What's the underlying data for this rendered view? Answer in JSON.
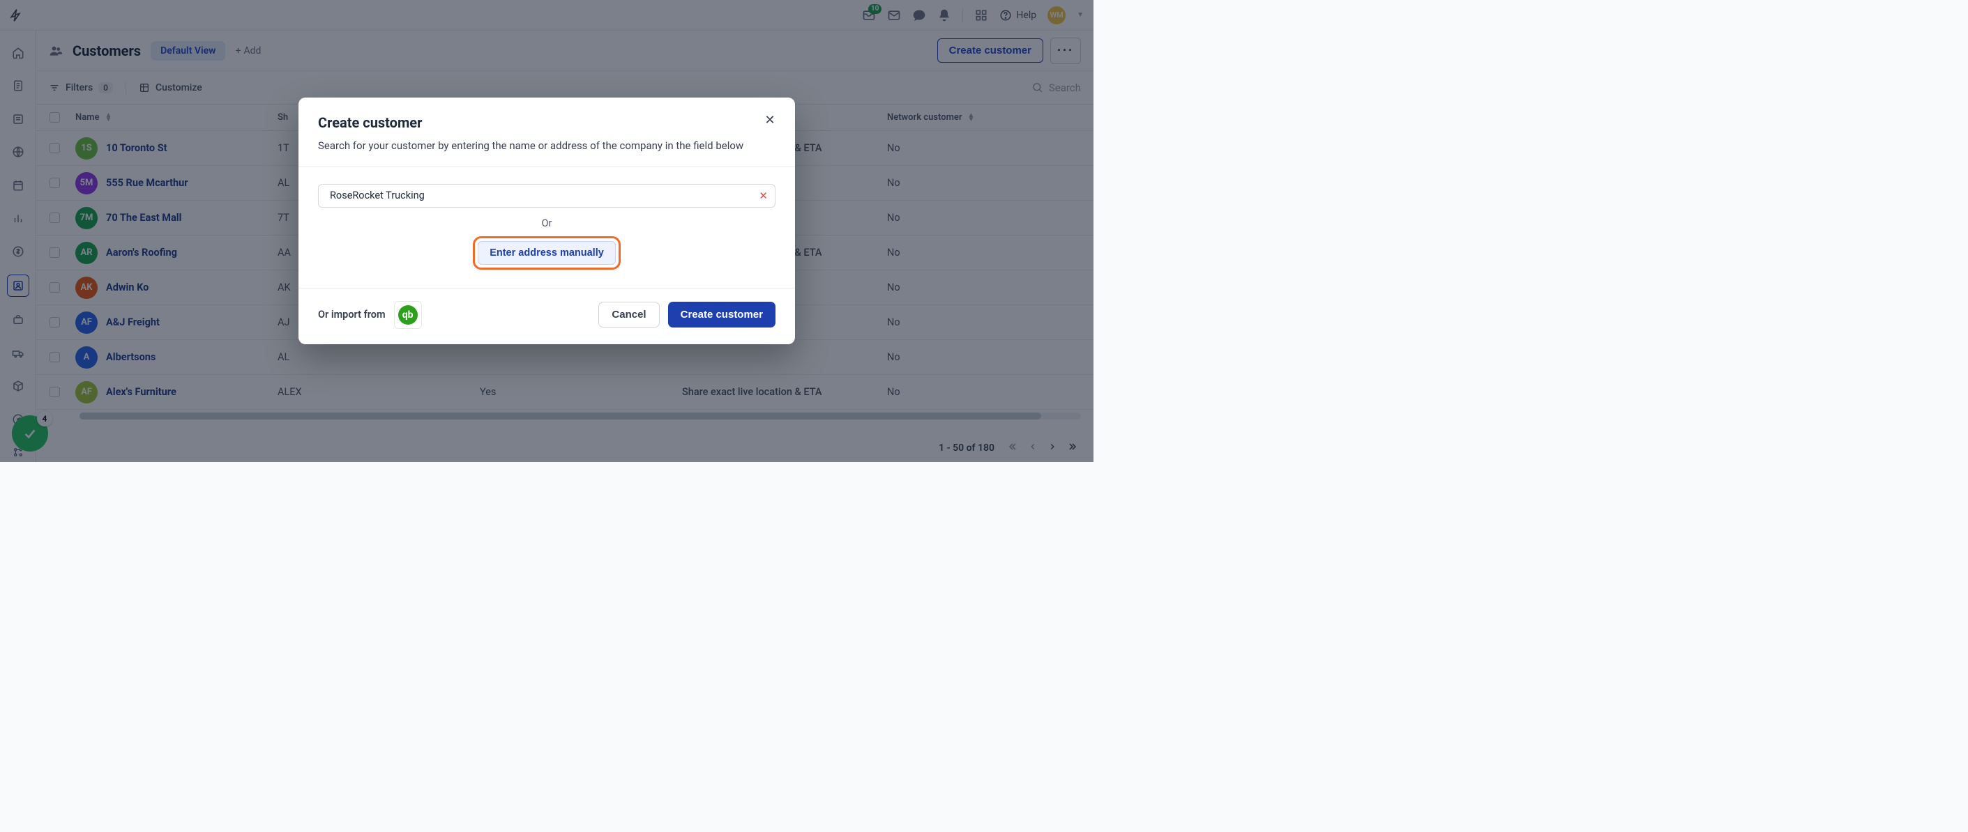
{
  "topbar": {
    "notification_count": "10",
    "help_label": "Help",
    "avatar_initials": "WM",
    "float_badge": "4"
  },
  "page": {
    "title": "Customers",
    "view_pill": "Default View",
    "add_label": "Add",
    "create_button": "Create customer"
  },
  "toolbar": {
    "filters_label": "Filters",
    "filters_count": "0",
    "customize_label": "Customize",
    "search_placeholder": "Search"
  },
  "columns": {
    "name": "Name",
    "shortcode": "Sh",
    "yn": "",
    "share": "",
    "network": "Network customer"
  },
  "rows": [
    {
      "avatar_bg": "#6cbf3c",
      "initials": "1S",
      "name": "10 Toronto St",
      "shortcode": "1T",
      "yn": "",
      "share": "Share exact live location & ETA",
      "net": "No"
    },
    {
      "avatar_bg": "#9333ea",
      "initials": "5M",
      "name": "555 Rue Mcarthur",
      "shortcode": "AL",
      "yn": "",
      "share": "",
      "net": "No"
    },
    {
      "avatar_bg": "#16a34a",
      "initials": "7M",
      "name": "70 The East Mall",
      "shortcode": "7T",
      "yn": "",
      "share": "",
      "net": "No"
    },
    {
      "avatar_bg": "#16a34a",
      "initials": "AR",
      "name": "Aaron's Roofing",
      "shortcode": "AA",
      "yn": "",
      "share": "Share exact live location & ETA",
      "net": "No"
    },
    {
      "avatar_bg": "#ea580c",
      "initials": "AK",
      "name": "Adwin Ko",
      "shortcode": "AK",
      "yn": "",
      "share": "",
      "net": "No"
    },
    {
      "avatar_bg": "#2563eb",
      "initials": "AF",
      "name": "A&J Freight",
      "shortcode": "AJ",
      "yn": "",
      "share": "",
      "net": "No"
    },
    {
      "avatar_bg": "#2563eb",
      "initials": "A",
      "name": "Albertsons",
      "shortcode": "AL",
      "yn": "",
      "share": "",
      "net": "No"
    },
    {
      "avatar_bg": "#a3c436",
      "initials": "AF",
      "name": "Alex's Furniture",
      "shortcode": "ALEX",
      "yn": "Yes",
      "share": "Share exact live location & ETA",
      "net": "No"
    }
  ],
  "footer": {
    "range": "1 - 50 of 180"
  },
  "modal": {
    "title": "Create customer",
    "subtitle": "Search for your customer by entering the name or address of the company in the field below",
    "search_value": "RoseRocket Trucking",
    "or_label": "Or",
    "manual_button": "Enter address manually",
    "import_label": "Or import from",
    "cancel": "Cancel",
    "create": "Create customer"
  }
}
